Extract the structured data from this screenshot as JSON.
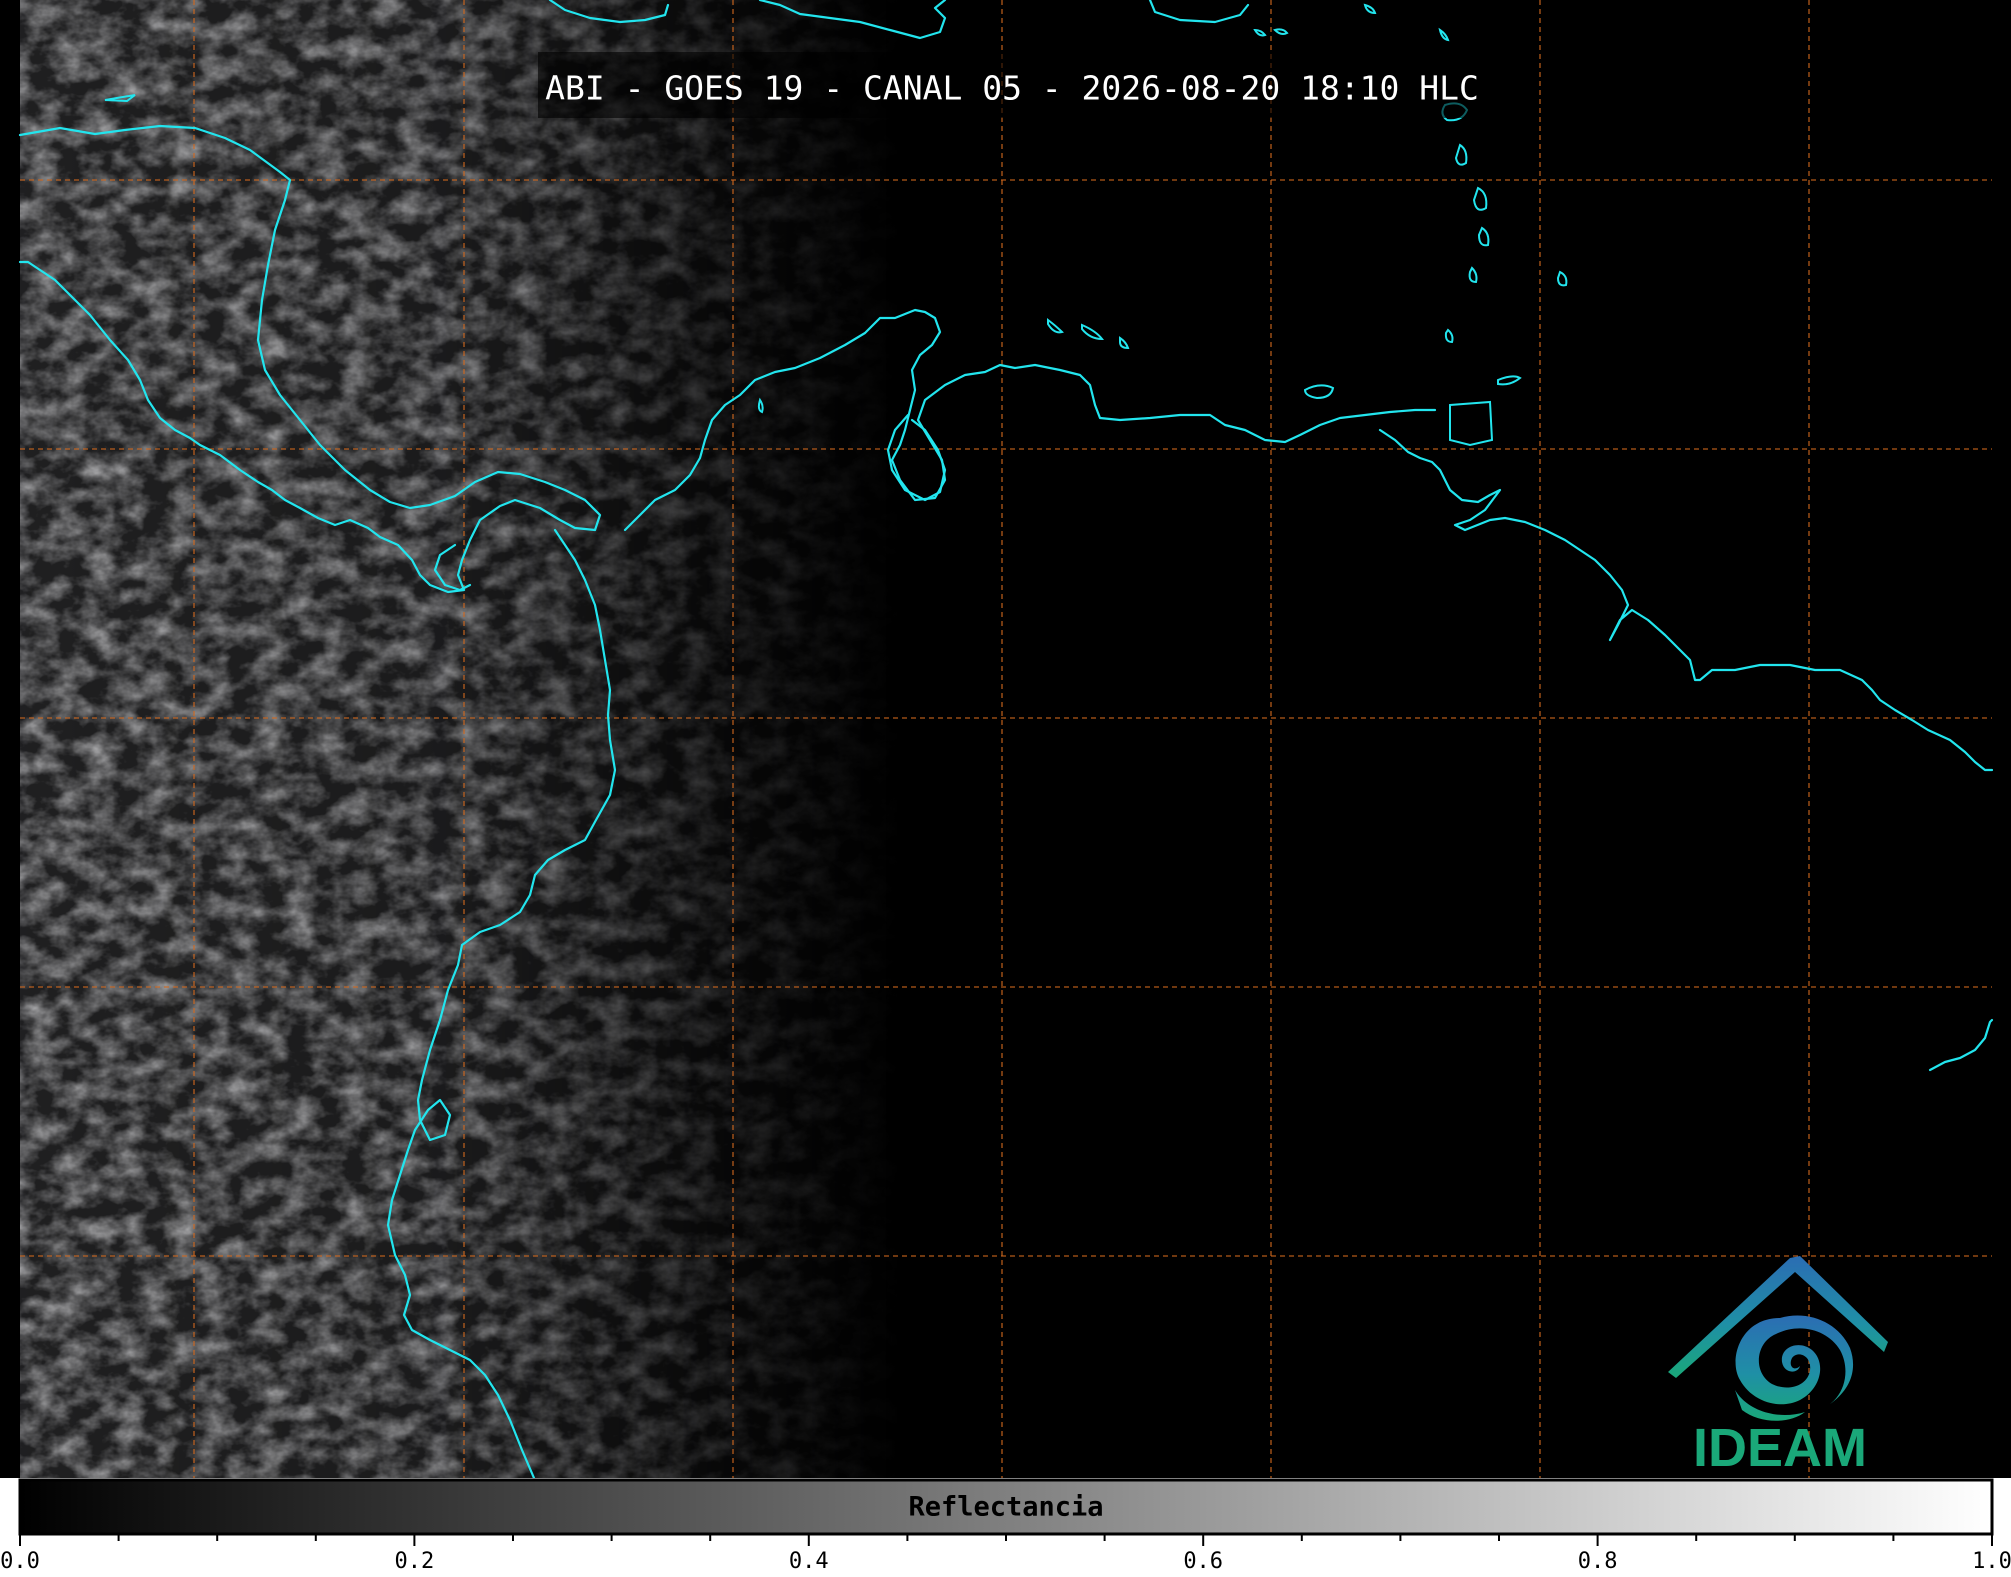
{
  "map": {
    "title": "ABI - GOES 19 - CANAL 05 - 2026-08-20 18:10 HLC",
    "grid_color": "#d2691e",
    "coastline_color": "#22e5ee",
    "background_color": "#000000"
  },
  "logo": {
    "text": "IDEAM",
    "color": "#1aa879"
  },
  "colorbar": {
    "label": "Reflectancia",
    "ticks": [
      "0.0",
      "0.2",
      "0.4",
      "0.6",
      "0.8",
      "1.0"
    ],
    "minor_ticks": [
      0.05,
      0.1,
      0.15,
      0.25,
      0.3,
      0.35,
      0.45,
      0.5,
      0.55,
      0.65,
      0.7,
      0.75,
      0.85,
      0.9,
      0.95
    ],
    "colormap": [
      "#000000",
      "#ffffff"
    ]
  }
}
